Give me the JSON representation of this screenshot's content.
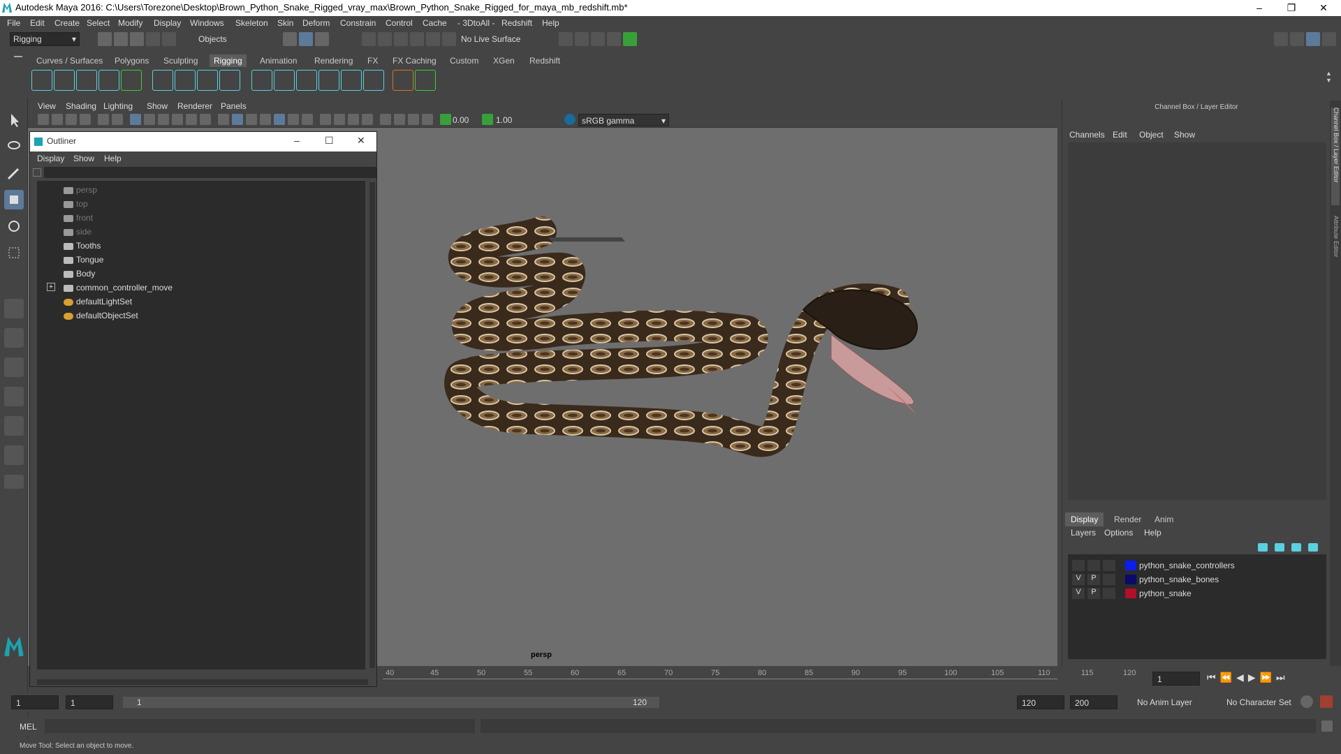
{
  "window": {
    "title": "Autodesk Maya 2016: C:\\Users\\Torezone\\Desktop\\Brown_Python_Snake_Rigged_vray_max\\Brown_Python_Snake_Rigged_for_maya_mb_redshift.mb*"
  },
  "menubar": [
    "File",
    "Edit",
    "Create",
    "Select",
    "Modify",
    "Display",
    "Windows",
    "Skeleton",
    "Skin",
    "Deform",
    "Constrain",
    "Control",
    "Cache",
    "- 3DtoAll -",
    "Redshift",
    "Help"
  ],
  "statusline": {
    "mode": "Rigging",
    "selection_mode": "Objects",
    "live_surface": "No Live Surface"
  },
  "shelf_tabs": [
    "Curves / Surfaces",
    "Polygons",
    "Sculpting",
    "Rigging",
    "Animation",
    "Rendering",
    "FX",
    "FX Caching",
    "Custom",
    "XGen",
    "Redshift"
  ],
  "active_shelf_tab": "Rigging",
  "viewport": {
    "menu": [
      "View",
      "Shading",
      "Lighting",
      "Show",
      "Renderer",
      "Panels"
    ],
    "exposure": "0.00",
    "gamma": "1.00",
    "color_space": "sRGB gamma",
    "camera_label": "persp"
  },
  "outliner": {
    "title": "Outliner",
    "menu": [
      "Display",
      "Show",
      "Help"
    ],
    "items": [
      {
        "label": "persp",
        "dim": true
      },
      {
        "label": "top",
        "dim": true
      },
      {
        "label": "front",
        "dim": true
      },
      {
        "label": "side",
        "dim": true
      },
      {
        "label": "Tooths",
        "dim": false
      },
      {
        "label": "Tongue",
        "dim": false
      },
      {
        "label": "Body",
        "dim": false
      },
      {
        "label": "common_controller_move",
        "dim": false,
        "expandable": true
      },
      {
        "label": "defaultLightSet",
        "dim": false
      },
      {
        "label": "defaultObjectSet",
        "dim": false
      }
    ]
  },
  "channel_box": {
    "title": "Channel Box / Layer Editor",
    "menu": [
      "Channels",
      "Edit",
      "Object",
      "Show"
    ],
    "side_tabs": [
      "Channel Box / Layer Editor",
      "Attribute Editor"
    ]
  },
  "layer_editor": {
    "tabs": [
      "Display",
      "Render",
      "Anim"
    ],
    "active_tab": "Display",
    "menu": [
      "Layers",
      "Options",
      "Help"
    ],
    "layers": [
      {
        "v": "",
        "p": "",
        "color": "#0a1ef0",
        "name": "python_snake_controllers"
      },
      {
        "v": "V",
        "p": "P",
        "color": "#0a0a6a",
        "name": "python_snake_bones"
      },
      {
        "v": "V",
        "p": "P",
        "color": "#b0102a",
        "name": "python_snake"
      }
    ]
  },
  "timeline": {
    "ticks": [
      "40",
      "45",
      "50",
      "55",
      "60",
      "65",
      "70",
      "75",
      "80",
      "85",
      "90",
      "95",
      "100",
      "105",
      "110",
      "115",
      "120"
    ],
    "current_frame": "1"
  },
  "range": {
    "start": "1",
    "playback_start": "1",
    "slider_start": "1",
    "slider_end": "120",
    "playback_end": "120",
    "end": "200",
    "anim_layer": "No Anim Layer",
    "character_set": "No Character Set"
  },
  "cmdline": {
    "label": "MEL"
  },
  "help_line": "Move Tool: Select an object to move.",
  "colors": {
    "accent_green": "#37d137",
    "accent_cyan": "#5ad0e0",
    "maya_teal": "#1aa3b0"
  }
}
